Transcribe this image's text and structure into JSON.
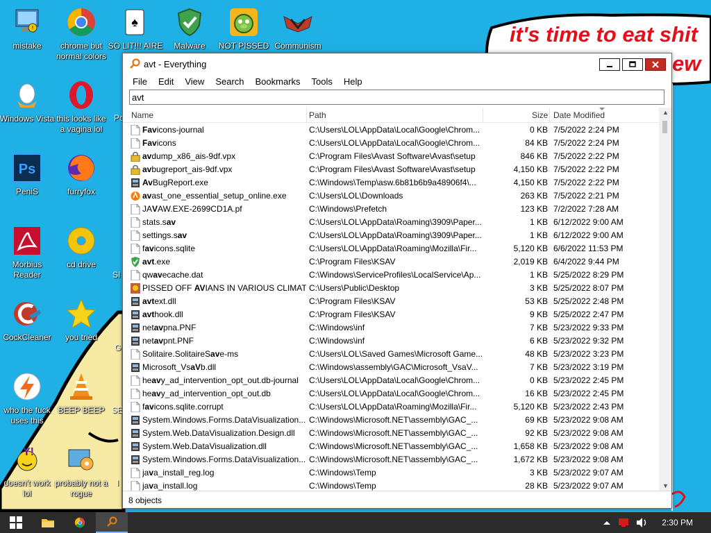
{
  "desktop": {
    "speech_line1": "it's time to eat shit",
    "speech_line2": "ew",
    "icons": [
      {
        "label": "mistake"
      },
      {
        "label": "chrome but normal colors"
      },
      {
        "label": "SO LIT!!! AIRE"
      },
      {
        "label": "Malware"
      },
      {
        "label": "NOT PISSED"
      },
      {
        "label": "Communism"
      },
      {
        "label": "Windows Vista"
      },
      {
        "label": "this looks like a vagina lol"
      },
      {
        "label": "PeniS"
      },
      {
        "label": "furryfox"
      },
      {
        "label": "Morbius Reader"
      },
      {
        "label": "cd drive"
      },
      {
        "label": "CockCleaner"
      },
      {
        "label": "you tried"
      },
      {
        "label": "who the fuck uses this"
      },
      {
        "label": "BEEP BEEP"
      },
      {
        "label": "doesn't work lol"
      },
      {
        "label": "probably not a rogue"
      }
    ],
    "partial_labels": [
      "Po",
      "SI",
      "G",
      "SE",
      "I"
    ]
  },
  "window": {
    "title": "avt - Everything",
    "menu": [
      "File",
      "Edit",
      "View",
      "Search",
      "Bookmarks",
      "Tools",
      "Help"
    ],
    "search_value": "avt",
    "columns": {
      "name": "Name",
      "path": "Path",
      "size": "Size",
      "date": "Date Modified"
    },
    "status": "8 objects",
    "rows": [
      {
        "pre": "",
        "hl": "Fav",
        "post": "icons-journal",
        "path": "C:\\Users\\LOL\\AppData\\Local\\Google\\Chrom...",
        "size": "0 KB",
        "date": "7/5/2022 2:24 PM",
        "icon": "doc"
      },
      {
        "pre": "",
        "hl": "Fav",
        "post": "icons",
        "path": "C:\\Users\\LOL\\AppData\\Local\\Google\\Chrom...",
        "size": "84 KB",
        "date": "7/5/2022 2:24 PM",
        "icon": "doc"
      },
      {
        "pre": "",
        "hl": "av",
        "post": "dump_x86_ais-9df.vpx",
        "path": "C:\\Program Files\\Avast Software\\Avast\\setup",
        "size": "846 KB",
        "date": "7/5/2022 2:22 PM",
        "icon": "lock"
      },
      {
        "pre": "",
        "hl": "av",
        "post": "bugreport_ais-9df.vpx",
        "path": "C:\\Program Files\\Avast Software\\Avast\\setup",
        "size": "4,150 KB",
        "date": "7/5/2022 2:22 PM",
        "icon": "lock"
      },
      {
        "pre": "",
        "hl": "Av",
        "post": "BugReport.exe",
        "path": "C:\\Windows\\Temp\\asw.6b81b6b9a48906f4\\...",
        "size": "4,150 KB",
        "date": "7/5/2022 2:22 PM",
        "icon": "film"
      },
      {
        "pre": "",
        "hl": "av",
        "post": "ast_one_essential_setup_online.exe",
        "path": "C:\\Users\\LOL\\Downloads",
        "size": "263 KB",
        "date": "7/5/2022 2:21 PM",
        "icon": "avast"
      },
      {
        "pre": "JA",
        "hl": "V",
        "post": "AW.EXE-2699CD1A.pf",
        "path": "C:\\Windows\\Prefetch",
        "size": "123 KB",
        "date": "7/2/2022 7:28 AM",
        "icon": "doc"
      },
      {
        "pre": "stats.s",
        "hl": "av",
        "post": "",
        "path": "C:\\Users\\LOL\\AppData\\Roaming\\3909\\Paper...",
        "size": "1 KB",
        "date": "6/12/2022 9:00 AM",
        "icon": "doc"
      },
      {
        "pre": "settings.s",
        "hl": "av",
        "post": "",
        "path": "C:\\Users\\LOL\\AppData\\Roaming\\3909\\Paper...",
        "size": "1 KB",
        "date": "6/12/2022 9:00 AM",
        "icon": "doc"
      },
      {
        "pre": "f",
        "hl": "av",
        "post": "icons.sqlite",
        "path": "C:\\Users\\LOL\\AppData\\Roaming\\Mozilla\\Fir...",
        "size": "5,120 KB",
        "date": "6/6/2022 11:53 PM",
        "icon": "doc"
      },
      {
        "pre": "",
        "hl": "avt",
        "post": ".exe",
        "path": "C:\\Program Files\\KSAV",
        "size": "2,019 KB",
        "date": "6/4/2022 9:44 PM",
        "icon": "shield"
      },
      {
        "pre": "qw",
        "hl": "av",
        "post": "ecache.dat",
        "path": "C:\\Windows\\ServiceProfiles\\LocalService\\Ap...",
        "size": "1 KB",
        "date": "5/25/2022 8:29 PM",
        "icon": "doc"
      },
      {
        "pre": "PISSED OFF ",
        "hl": "AV",
        "post": "IANS IN VARIOUS CLIMATE...",
        "path": "C:\\Users\\Public\\Desktop",
        "size": "3 KB",
        "date": "5/25/2022 8:07 PM",
        "icon": "pic"
      },
      {
        "pre": "",
        "hl": "avt",
        "post": "ext.dll",
        "path": "C:\\Program Files\\KSAV",
        "size": "53 KB",
        "date": "5/25/2022 2:48 PM",
        "icon": "film"
      },
      {
        "pre": "",
        "hl": "avt",
        "post": "hook.dll",
        "path": "C:\\Program Files\\KSAV",
        "size": "9 KB",
        "date": "5/25/2022 2:47 PM",
        "icon": "film"
      },
      {
        "pre": "net",
        "hl": "av",
        "post": "pna.PNF",
        "path": "C:\\Windows\\inf",
        "size": "7 KB",
        "date": "5/23/2022 9:33 PM",
        "icon": "film"
      },
      {
        "pre": "net",
        "hl": "av",
        "post": "pnt.PNF",
        "path": "C:\\Windows\\inf",
        "size": "6 KB",
        "date": "5/23/2022 9:32 PM",
        "icon": "film"
      },
      {
        "pre": "Solitaire.SolitaireS",
        "hl": "av",
        "post": "e-ms",
        "path": "C:\\Users\\LOL\\Saved Games\\Microsoft Game...",
        "size": "48 KB",
        "date": "5/23/2022 3:23 PM",
        "icon": "doc"
      },
      {
        "pre": "Microsoft_Vs",
        "hl": "aV",
        "post": "b.dll",
        "path": "C:\\Windows\\assembly\\GAC\\Microsoft_VsaV...",
        "size": "7 KB",
        "date": "5/23/2022 3:19 PM",
        "icon": "film"
      },
      {
        "pre": "he",
        "hl": "av",
        "post": "y_ad_intervention_opt_out.db-journal",
        "path": "C:\\Users\\LOL\\AppData\\Local\\Google\\Chrom...",
        "size": "0 KB",
        "date": "5/23/2022 2:45 PM",
        "icon": "doc"
      },
      {
        "pre": "he",
        "hl": "av",
        "post": "y_ad_intervention_opt_out.db",
        "path": "C:\\Users\\LOL\\AppData\\Local\\Google\\Chrom...",
        "size": "16 KB",
        "date": "5/23/2022 2:45 PM",
        "icon": "doc"
      },
      {
        "pre": "f",
        "hl": "av",
        "post": "icons.sqlite.corrupt",
        "path": "C:\\Users\\LOL\\AppData\\Roaming\\Mozilla\\Fir...",
        "size": "5,120 KB",
        "date": "5/23/2022 2:43 PM",
        "icon": "doc"
      },
      {
        "pre": "System.Windows.Forms.DataVisualization....",
        "hl": "",
        "post": "",
        "path": "C:\\Windows\\Microsoft.NET\\assembly\\GAC_...",
        "size": "69 KB",
        "date": "5/23/2022 9:08 AM",
        "icon": "film"
      },
      {
        "pre": "System.Web.DataVisualization.Design.dll",
        "hl": "",
        "post": "",
        "path": "C:\\Windows\\Microsoft.NET\\assembly\\GAC_...",
        "size": "92 KB",
        "date": "5/23/2022 9:08 AM",
        "icon": "film"
      },
      {
        "pre": "System.Web.DataVisualization.dll",
        "hl": "",
        "post": "",
        "path": "C:\\Windows\\Microsoft.NET\\assembly\\GAC_...",
        "size": "1,658 KB",
        "date": "5/23/2022 9:08 AM",
        "icon": "film"
      },
      {
        "pre": "System.Windows.Forms.DataVisualization....",
        "hl": "",
        "post": "",
        "path": "C:\\Windows\\Microsoft.NET\\assembly\\GAC_...",
        "size": "1,672 KB",
        "date": "5/23/2022 9:08 AM",
        "icon": "film"
      },
      {
        "pre": "ja",
        "hl": "v",
        "post": "a_install_reg.log",
        "path": "C:\\Windows\\Temp",
        "size": "3 KB",
        "date": "5/23/2022 9:07 AM",
        "icon": "doc"
      },
      {
        "pre": "ja",
        "hl": "v",
        "post": "a_install.log",
        "path": "C:\\Windows\\Temp",
        "size": "28 KB",
        "date": "5/23/2022 9:07 AM",
        "icon": "doc"
      }
    ]
  },
  "taskbar": {
    "clock": "2:30 PM"
  }
}
